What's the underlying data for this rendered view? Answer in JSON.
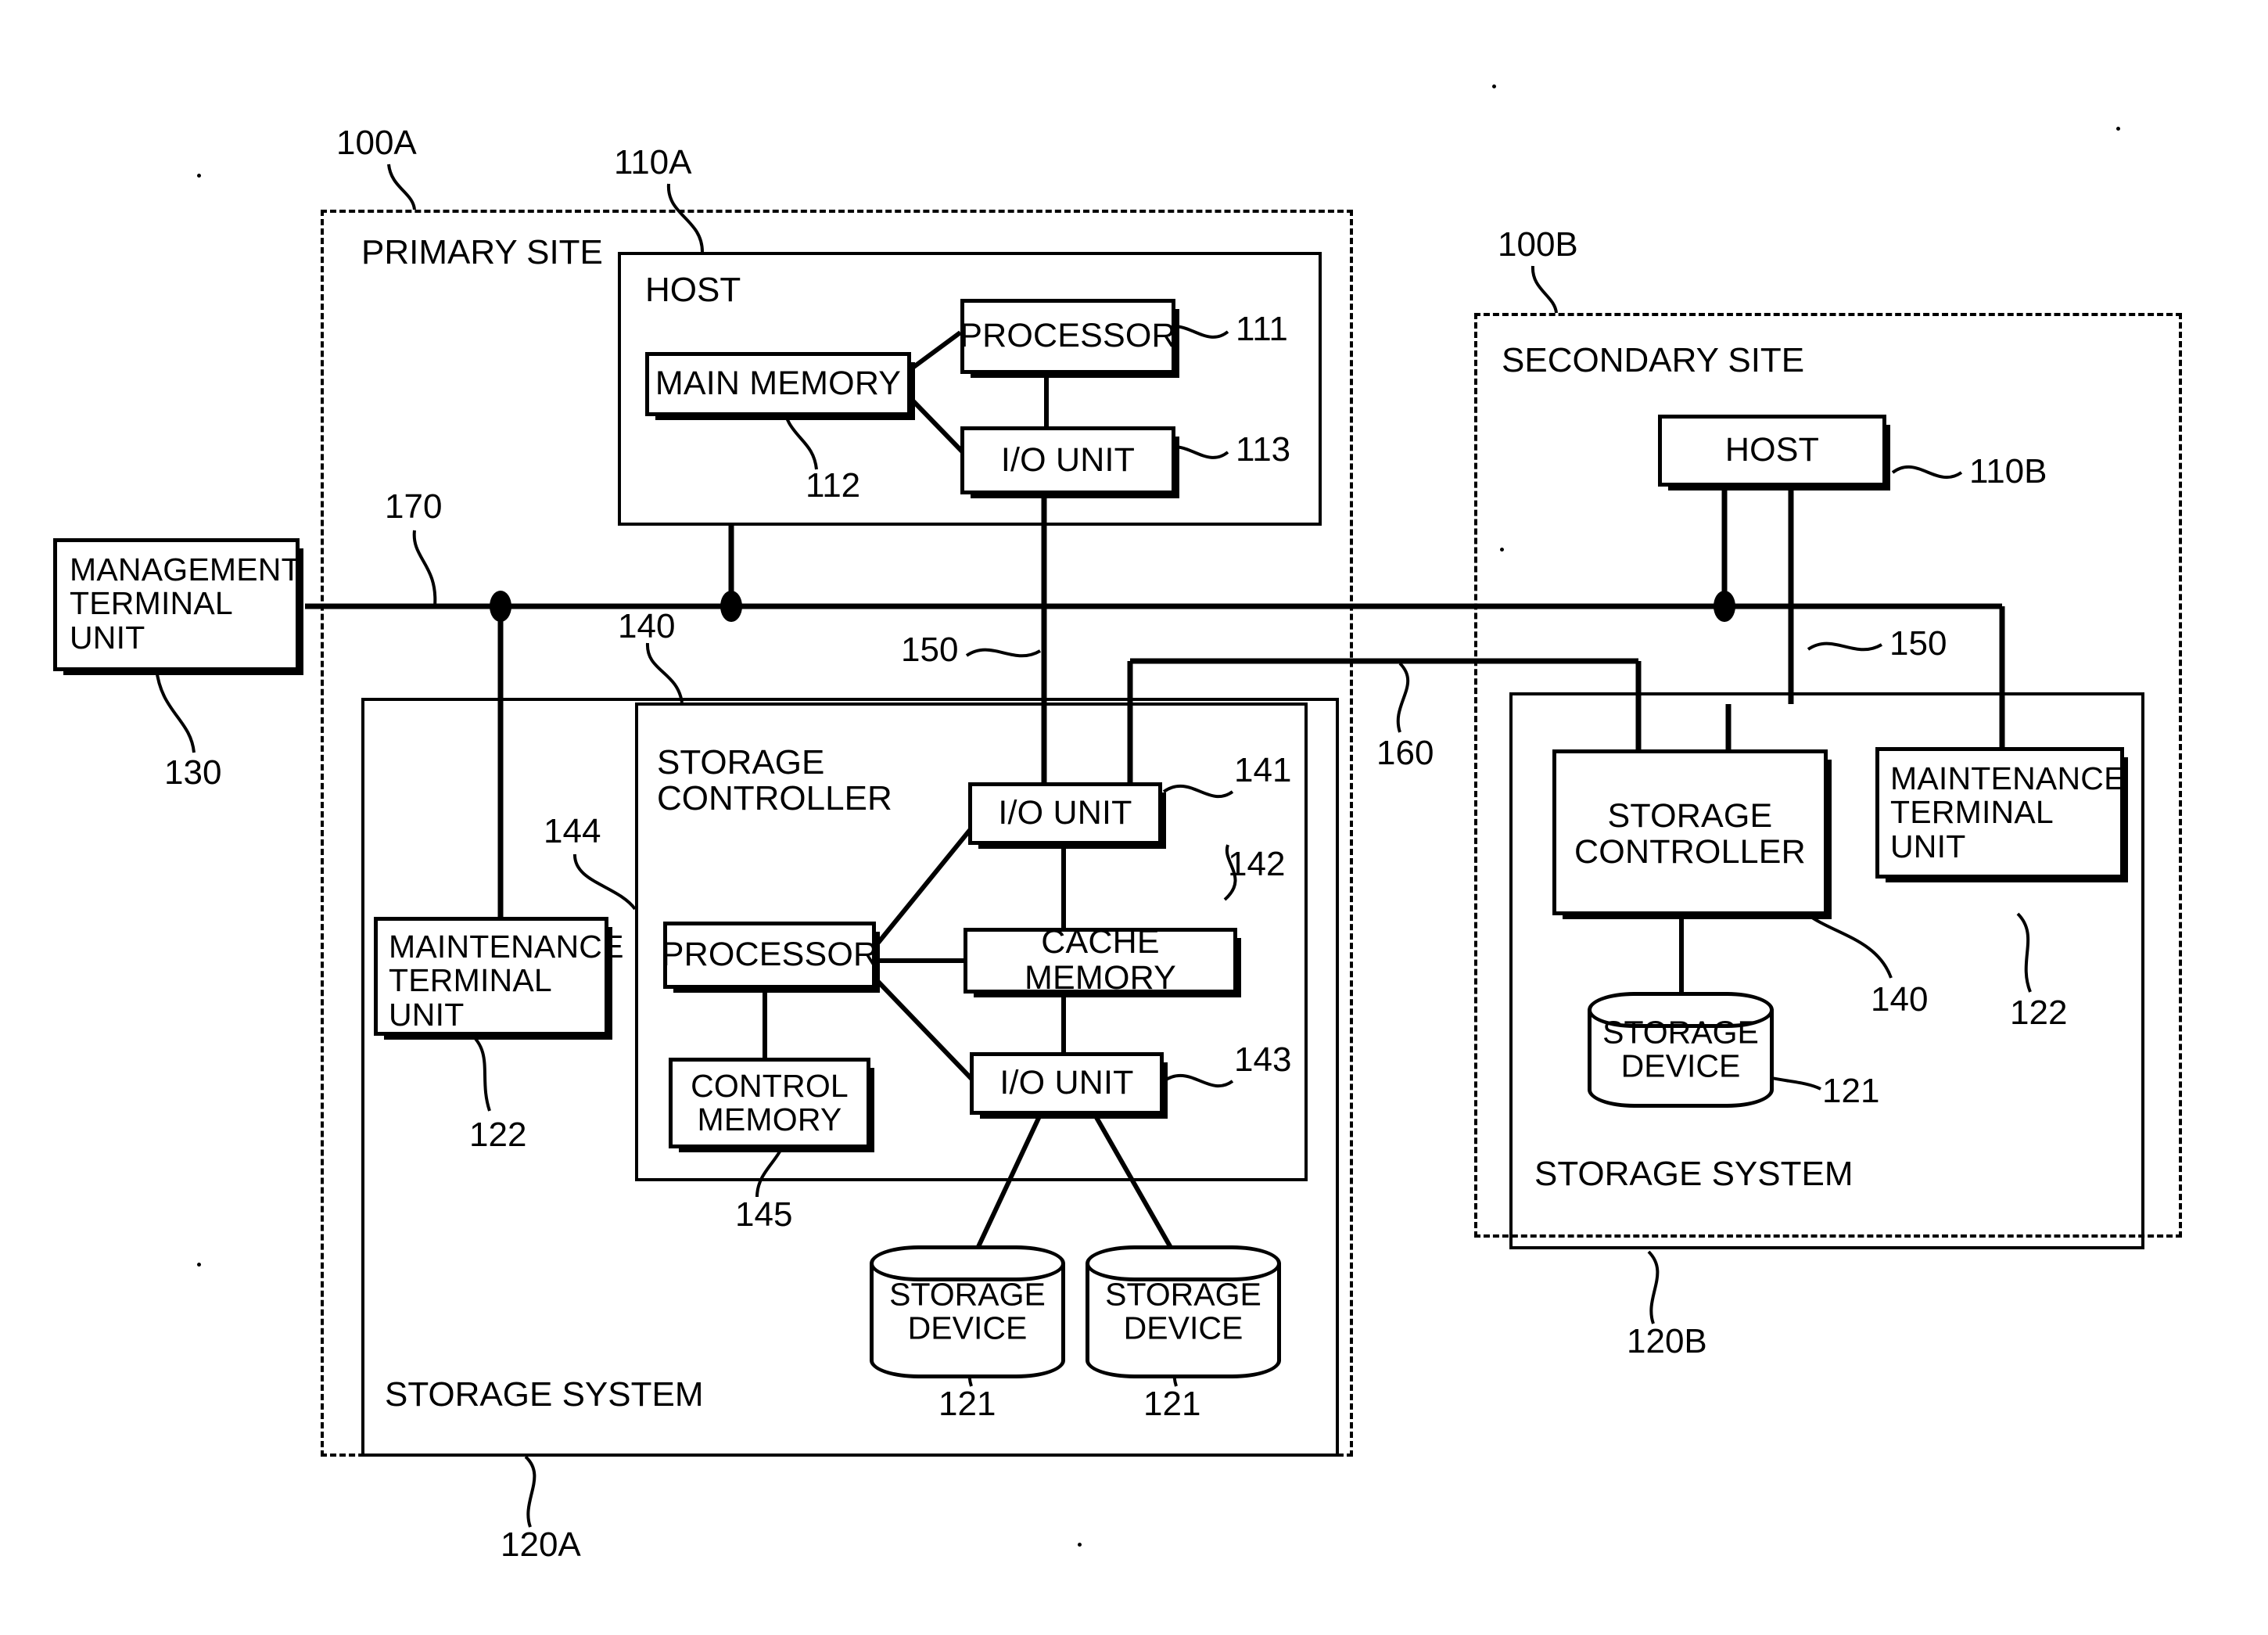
{
  "figure": {
    "title": "Storage system remote copy configuration diagram",
    "line_color": "#000000",
    "background": "#ffffff"
  },
  "primary_site": {
    "caption": "PRIMARY SITE",
    "ref": "100A",
    "host": {
      "caption": "HOST",
      "ref": "110A",
      "processor": {
        "label": "PROCESSOR",
        "ref": "111"
      },
      "main_memory": {
        "label": "MAIN MEMORY",
        "ref": "112"
      },
      "io_unit": {
        "label": "I/O UNIT",
        "ref": "113"
      }
    },
    "storage_system": {
      "caption": "STORAGE SYSTEM",
      "ref": "120A",
      "maintenance_terminal_unit": {
        "label": "MAINTENANCE\nTERMINAL\nUNIT",
        "ref": "122"
      },
      "storage_controller": {
        "caption": "STORAGE\nCONTROLLER",
        "ref": "140",
        "processor": {
          "label": "PROCESSOR",
          "ref": "144"
        },
        "control_memory": {
          "label": "CONTROL\nMEMORY",
          "ref": "145"
        },
        "io_unit_top": {
          "label": "I/O UNIT",
          "ref": "141"
        },
        "cache_memory": {
          "label": "CACHE MEMORY",
          "ref": "142"
        },
        "io_unit_bottom": {
          "label": "I/O UNIT",
          "ref": "143"
        }
      },
      "storage_devices": [
        {
          "label": "STORAGE\nDEVICE",
          "ref": "121"
        },
        {
          "label": "STORAGE\nDEVICE",
          "ref": "121"
        }
      ]
    }
  },
  "secondary_site": {
    "caption": "SECONDARY SITE",
    "ref": "100B",
    "host": {
      "caption": "HOST",
      "ref": "110B"
    },
    "storage_system": {
      "caption": "STORAGE SYSTEM",
      "ref": "120B",
      "storage_controller": {
        "caption": "STORAGE\nCONTROLLER",
        "ref": "140"
      },
      "maintenance_terminal_unit": {
        "label": "MAINTENANCE\nTERMINAL\nUNIT",
        "ref": "122"
      },
      "storage_device": {
        "label": "STORAGE\nDEVICE",
        "ref": "121"
      }
    }
  },
  "management_terminal_unit": {
    "label": "MANAGEMENT\nTERMINAL\nUNIT",
    "ref": "130"
  },
  "networks": {
    "management_network": {
      "ref": "170"
    },
    "data_path_primary": {
      "ref": "150"
    },
    "data_path_secondary": {
      "ref": "150"
    },
    "remote_copy_link": {
      "ref": "160"
    }
  }
}
